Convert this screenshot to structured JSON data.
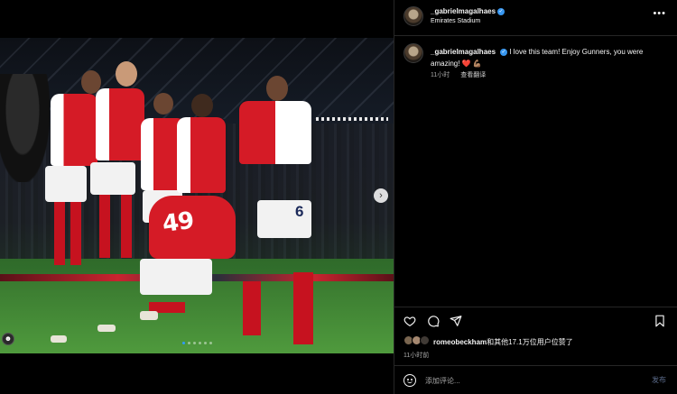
{
  "header": {
    "username": "_gabrielmagalhaes",
    "location": "Emirates Stadium",
    "more_glyph": "•••"
  },
  "caption": {
    "username": "_gabrielmagalhaes",
    "text": "I love this team! Enjoy Gunners, you were amazing!",
    "emoji_heart": "❤️",
    "emoji_arm": "💪🏽",
    "time": "11小时",
    "translate": "查看翻译"
  },
  "photo": {
    "shirt_number_front": "49",
    "shirt_number_back": "6",
    "next_glyph": "›",
    "tag_glyph": "☻",
    "slide_count": 6,
    "active_slide": 0
  },
  "likes": {
    "user": "romeobeckham",
    "rest": "和其他17.1万位用户位赞了"
  },
  "post_time": "11小时前",
  "comment": {
    "placeholder": "添加评论...",
    "post_label": "发布"
  },
  "icons": {
    "like": "heart-outline-icon",
    "comment": "comment-bubble-icon",
    "share": "paper-plane-icon",
    "save": "bookmark-icon",
    "verified": "verified-badge-icon"
  },
  "colors": {
    "accent": "#3897f0",
    "like_red": "#ff2d55",
    "arsenal_red": "#d51b26",
    "background": "#000000"
  }
}
